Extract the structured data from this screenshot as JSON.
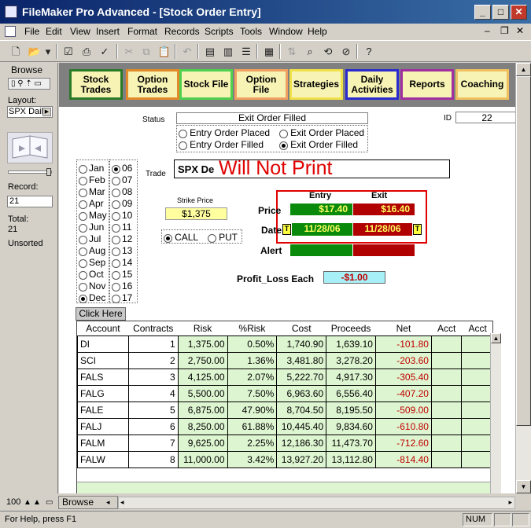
{
  "window": {
    "title": "FileMaker Pro Advanced - [Stock Order Entry]"
  },
  "menu": [
    "File",
    "Edit",
    "View",
    "Insert",
    "Format",
    "Records",
    "Scripts",
    "Tools",
    "Window",
    "Help"
  ],
  "statusarea": {
    "mode": "Browse",
    "layout_label": "Layout:",
    "layout_value": "SPX Dail",
    "record_label": "Record:",
    "record_value": "21",
    "total_label": "Total:",
    "total_value": "21",
    "sort_status": "Unsorted"
  },
  "nav": [
    {
      "label": "Stock Trades",
      "border": "#2a7a2a"
    },
    {
      "label": "Option Trades",
      "border": "#e08a2a"
    },
    {
      "label": "Stock File",
      "border": "#4fd04f"
    },
    {
      "label": "Option File",
      "border": "#f0a060"
    },
    {
      "label": "Strategies",
      "border": "#f0e04a"
    },
    {
      "label": "Daily Activities",
      "border": "#2a2ad0"
    },
    {
      "label": "Reports",
      "border": "#a030a0"
    },
    {
      "label": "Coaching",
      "border": "#f0c060"
    }
  ],
  "status": {
    "label": "Status",
    "value": "Exit Order Filled",
    "options": [
      {
        "label": "Entry Order Placed",
        "on": false
      },
      {
        "label": "Exit Order Placed",
        "on": false
      },
      {
        "label": "Entry Order Filled",
        "on": false
      },
      {
        "label": "Exit Order Filled",
        "on": true
      }
    ]
  },
  "id": {
    "label": "ID",
    "value": "22"
  },
  "months": [
    {
      "label": "Jan",
      "on": false
    },
    {
      "label": "Feb",
      "on": false
    },
    {
      "label": "Mar",
      "on": false
    },
    {
      "label": "Apr",
      "on": false
    },
    {
      "label": "May",
      "on": false
    },
    {
      "label": "Jun",
      "on": false
    },
    {
      "label": "Jul",
      "on": false
    },
    {
      "label": "Aug",
      "on": false
    },
    {
      "label": "Sep",
      "on": false
    },
    {
      "label": "Oct",
      "on": false
    },
    {
      "label": "Nov",
      "on": false
    },
    {
      "label": "Dec",
      "on": true
    }
  ],
  "years": [
    {
      "label": "06",
      "on": true
    },
    {
      "label": "07",
      "on": false
    },
    {
      "label": "08",
      "on": false
    },
    {
      "label": "09",
      "on": false
    },
    {
      "label": "10",
      "on": false
    },
    {
      "label": "11",
      "on": false
    },
    {
      "label": "12",
      "on": false
    },
    {
      "label": "13",
      "on": false
    },
    {
      "label": "14",
      "on": false
    },
    {
      "label": "15",
      "on": false
    },
    {
      "label": "16",
      "on": false
    },
    {
      "label": "17",
      "on": false
    }
  ],
  "trade": {
    "label": "Trade",
    "value": "SPX De",
    "overlay": "Will Not Print"
  },
  "strike": {
    "label": "Strike Price",
    "value": "$1,375"
  },
  "callput": [
    {
      "label": "CALL",
      "on": true
    },
    {
      "label": "PUT",
      "on": false
    }
  ],
  "entryexit": {
    "entry_header": "Entry",
    "exit_header": "Exit",
    "price_label": "Price",
    "entry_price": "$17.40",
    "exit_price": "$16.40",
    "date_label": "Date",
    "entry_date": "11/28/06",
    "exit_date": "11/28/06",
    "date_btn": "T",
    "alert_label": "Alert"
  },
  "profit": {
    "label": "Profit_Loss Each",
    "value": "-$1.00"
  },
  "click_here": "Click Here",
  "table": {
    "headers": [
      "Account",
      "Contracts",
      "Risk",
      "%Risk",
      "Cost",
      "Proceeds",
      "Net",
      "Acct",
      "Acct"
    ],
    "rows": [
      [
        "DI",
        "1",
        "1,375.00",
        "0.50%",
        "1,740.90",
        "1,639.10",
        "-101.80"
      ],
      [
        "SCI",
        "2",
        "2,750.00",
        "1.36%",
        "3,481.80",
        "3,278.20",
        "-203.60"
      ],
      [
        "FALS",
        "3",
        "4,125.00",
        "2.07%",
        "5,222.70",
        "4,917.30",
        "-305.40"
      ],
      [
        "FALG",
        "4",
        "5,500.00",
        "7.50%",
        "6,963.60",
        "6,556.40",
        "-407.20"
      ],
      [
        "FALE",
        "5",
        "6,875.00",
        "47.90%",
        "8,704.50",
        "8,195.50",
        "-509.00"
      ],
      [
        "FALJ",
        "6",
        "8,250.00",
        "61.88%",
        "10,445.40",
        "9,834.60",
        "-610.80"
      ],
      [
        "FALM",
        "7",
        "9,625.00",
        "2.25%",
        "12,186.30",
        "11,473.70",
        "-712.60"
      ],
      [
        "FALW",
        "8",
        "11,000.00",
        "3.42%",
        "13,927.20",
        "13,112.80",
        "-814.40"
      ]
    ]
  },
  "bottom": {
    "zoom": "100",
    "mode": "Browse"
  },
  "statusbar": {
    "help": "For Help, press F1",
    "num": "NUM"
  }
}
